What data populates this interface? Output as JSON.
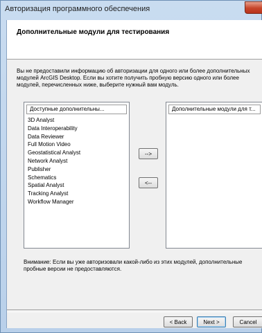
{
  "window": {
    "title": "Авторизация программного обеспечения"
  },
  "header": {
    "title": "Дополнительные модули для тестирования"
  },
  "info_lines": [
    "Вы не предоставили информацию об авторизации для одного или более дополнительных",
    "модулей ArcGIS Desktop.  Если вы хотите получить пробную версию одного или более",
    "модулей, перечисленных ниже, выберите нужный вам модуль."
  ],
  "available_list": {
    "header": "Доступные дополнительны...",
    "items": [
      "3D Analyst",
      "Data Interoperability",
      "Data Reviewer",
      "Full Motion Video",
      "Geostatistical Analyst",
      "Network Analyst",
      "Publisher",
      "Schematics",
      "Spatial Analyst",
      "Tracking Analyst",
      "Workflow Manager"
    ]
  },
  "selected_list": {
    "header": "Дополнительные модули для т..."
  },
  "move_buttons": {
    "add_label": "-->",
    "remove_label": "<--"
  },
  "note_lines": [
    "Внимание: Если вы уже авторизовали какой-либо из этих модулей, дополнительные",
    "пробные версии не предоставляются."
  ],
  "footer": {
    "back_label": "< Back",
    "next_label": "Next >",
    "cancel_label": "Cancel"
  }
}
